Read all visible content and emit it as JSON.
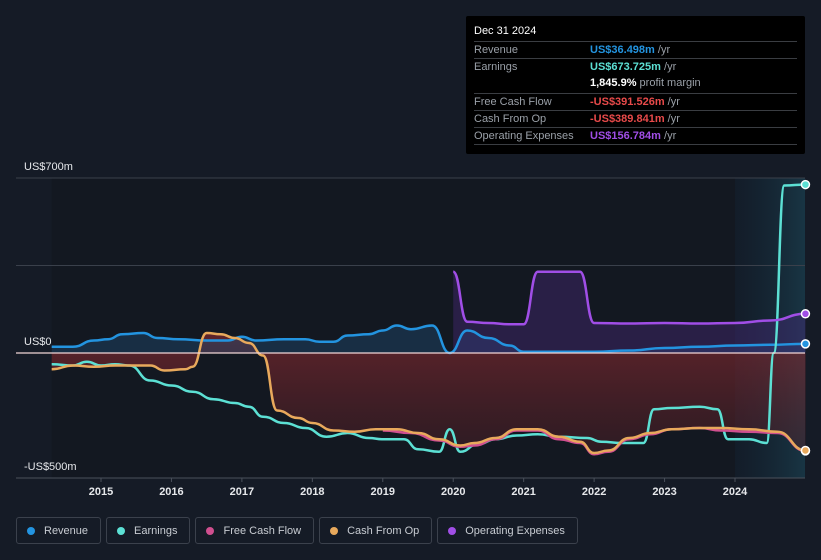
{
  "chart_data": {
    "type": "line",
    "title": "",
    "xlabel": "",
    "ylabel": "",
    "y_axis": {
      "top_label": "US$700m",
      "zero_label": "US$0",
      "bottom_label": "-US$500m",
      "ylim": [
        -500,
        700
      ],
      "unit": "US$m"
    },
    "x_ticks": [
      "2015",
      "2016",
      "2017",
      "2018",
      "2019",
      "2020",
      "2021",
      "2022",
      "2023",
      "2024"
    ],
    "x_range": [
      2014.3,
      2025.0
    ],
    "grid": true,
    "forecast_shade_start": 2024.0,
    "series": [
      {
        "name": "Revenue",
        "color": "#2394e0",
        "points": [
          [
            2014.3,
            25
          ],
          [
            2014.6,
            25
          ],
          [
            2014.9,
            50
          ],
          [
            2015.1,
            55
          ],
          [
            2015.3,
            75
          ],
          [
            2015.6,
            80
          ],
          [
            2015.8,
            60
          ],
          [
            2016.1,
            55
          ],
          [
            2016.5,
            50
          ],
          [
            2016.8,
            50
          ],
          [
            2017.0,
            65
          ],
          [
            2017.2,
            50
          ],
          [
            2017.6,
            55
          ],
          [
            2017.9,
            55
          ],
          [
            2018.1,
            45
          ],
          [
            2018.3,
            45
          ],
          [
            2018.5,
            70
          ],
          [
            2018.8,
            75
          ],
          [
            2019.0,
            90
          ],
          [
            2019.2,
            110
          ],
          [
            2019.4,
            95
          ],
          [
            2019.7,
            110
          ],
          [
            2019.95,
            0
          ],
          [
            2020.2,
            90
          ],
          [
            2020.5,
            60
          ],
          [
            2020.8,
            30
          ],
          [
            2021.0,
            5
          ],
          [
            2021.5,
            5
          ],
          [
            2022.0,
            5
          ],
          [
            2022.5,
            10
          ],
          [
            2023.0,
            20
          ],
          [
            2023.5,
            25
          ],
          [
            2024.0,
            30
          ],
          [
            2024.5,
            33
          ],
          [
            2025.0,
            36.5
          ]
        ]
      },
      {
        "name": "Earnings",
        "color": "#5ce0d4",
        "points": [
          [
            2014.3,
            -45
          ],
          [
            2014.6,
            -50
          ],
          [
            2014.8,
            -35
          ],
          [
            2015.0,
            -50
          ],
          [
            2015.2,
            -45
          ],
          [
            2015.4,
            -50
          ],
          [
            2015.7,
            -110
          ],
          [
            2016.0,
            -130
          ],
          [
            2016.3,
            -155
          ],
          [
            2016.6,
            -185
          ],
          [
            2016.9,
            -200
          ],
          [
            2017.1,
            -215
          ],
          [
            2017.3,
            -255
          ],
          [
            2017.6,
            -280
          ],
          [
            2017.9,
            -300
          ],
          [
            2018.2,
            -335
          ],
          [
            2018.5,
            -320
          ],
          [
            2018.8,
            -340
          ],
          [
            2019.0,
            -345
          ],
          [
            2019.3,
            -345
          ],
          [
            2019.5,
            -385
          ],
          [
            2019.8,
            -395
          ],
          [
            2019.95,
            -305
          ],
          [
            2020.1,
            -395
          ],
          [
            2020.35,
            -365
          ],
          [
            2020.6,
            -345
          ],
          [
            2020.9,
            -330
          ],
          [
            2021.2,
            -325
          ],
          [
            2021.5,
            -335
          ],
          [
            2021.9,
            -340
          ],
          [
            2022.1,
            -355
          ],
          [
            2022.4,
            -360
          ],
          [
            2022.7,
            -360
          ],
          [
            2022.85,
            -225
          ],
          [
            2023.1,
            -220
          ],
          [
            2023.5,
            -215
          ],
          [
            2023.75,
            -225
          ],
          [
            2023.9,
            -345
          ],
          [
            2024.2,
            -345
          ],
          [
            2024.45,
            -360
          ],
          [
            2024.55,
            0
          ],
          [
            2024.7,
            670
          ],
          [
            2025.0,
            673.7
          ]
        ]
      },
      {
        "name": "Free Cash Flow",
        "color": "#d04f8f",
        "points": [
          [
            2019.0,
            -310
          ],
          [
            2019.4,
            -320
          ],
          [
            2019.8,
            -350
          ],
          [
            2020.1,
            -375
          ],
          [
            2020.3,
            -370
          ],
          [
            2020.6,
            -345
          ],
          [
            2020.9,
            -310
          ],
          [
            2021.2,
            -310
          ],
          [
            2021.5,
            -345
          ],
          [
            2021.8,
            -360
          ],
          [
            2022.0,
            -405
          ],
          [
            2022.2,
            -395
          ],
          [
            2022.5,
            -345
          ],
          [
            2022.8,
            -325
          ],
          [
            2023.1,
            -305
          ],
          [
            2023.5,
            -300
          ],
          [
            2023.8,
            -310
          ],
          [
            2024.2,
            -315
          ],
          [
            2024.6,
            -320
          ],
          [
            2025.0,
            -391.5
          ]
        ]
      },
      {
        "name": "Cash From Op",
        "color": "#e8a95c",
        "points": [
          [
            2014.3,
            -65
          ],
          [
            2014.6,
            -50
          ],
          [
            2014.9,
            -55
          ],
          [
            2015.2,
            -50
          ],
          [
            2015.5,
            -50
          ],
          [
            2015.7,
            -50
          ],
          [
            2015.9,
            -70
          ],
          [
            2016.2,
            -65
          ],
          [
            2016.3,
            -55
          ],
          [
            2016.5,
            80
          ],
          [
            2016.7,
            75
          ],
          [
            2016.9,
            60
          ],
          [
            2017.1,
            40
          ],
          [
            2017.3,
            -10
          ],
          [
            2017.5,
            -230
          ],
          [
            2017.8,
            -260
          ],
          [
            2018.0,
            -280
          ],
          [
            2018.3,
            -310
          ],
          [
            2018.6,
            -315
          ],
          [
            2018.9,
            -305
          ],
          [
            2019.2,
            -305
          ],
          [
            2019.5,
            -320
          ],
          [
            2019.8,
            -345
          ],
          [
            2020.1,
            -370
          ],
          [
            2020.3,
            -360
          ],
          [
            2020.6,
            -340
          ],
          [
            2020.9,
            -305
          ],
          [
            2021.2,
            -305
          ],
          [
            2021.5,
            -335
          ],
          [
            2021.8,
            -355
          ],
          [
            2022.0,
            -400
          ],
          [
            2022.2,
            -390
          ],
          [
            2022.5,
            -340
          ],
          [
            2022.8,
            -320
          ],
          [
            2023.1,
            -305
          ],
          [
            2023.5,
            -300
          ],
          [
            2023.8,
            -300
          ],
          [
            2024.2,
            -305
          ],
          [
            2024.6,
            -315
          ],
          [
            2025.0,
            -389.8
          ]
        ]
      },
      {
        "name": "Operating Expenses",
        "color": "#a04ee6",
        "points": [
          [
            2020.0,
            325
          ],
          [
            2020.2,
            125
          ],
          [
            2020.5,
            120
          ],
          [
            2020.8,
            115
          ],
          [
            2021.0,
            115
          ],
          [
            2021.2,
            325
          ],
          [
            2021.5,
            325
          ],
          [
            2021.8,
            325
          ],
          [
            2022.0,
            120
          ],
          [
            2022.5,
            118
          ],
          [
            2023.0,
            120
          ],
          [
            2023.5,
            118
          ],
          [
            2024.0,
            120
          ],
          [
            2024.5,
            130
          ],
          [
            2025.0,
            156.8
          ]
        ]
      }
    ]
  },
  "tooltip": {
    "date": "Dec 31 2024",
    "rows": [
      {
        "label": "Revenue",
        "value": "US$36.498m",
        "unit": " /yr",
        "color": "#2394e0"
      },
      {
        "label": "Earnings",
        "value": "US$673.725m",
        "unit": " /yr",
        "color": "#5ce0d4"
      },
      {
        "label": "",
        "value": "1,845.9%",
        "unit": " profit margin",
        "color": "#ffffff"
      },
      {
        "label": "Free Cash Flow",
        "value": "-US$391.526m",
        "unit": " /yr",
        "color": "#e84a4a"
      },
      {
        "label": "Cash From Op",
        "value": "-US$389.841m",
        "unit": " /yr",
        "color": "#e84a4a"
      },
      {
        "label": "Operating Expenses",
        "value": "US$156.784m",
        "unit": " /yr",
        "color": "#a04ee6"
      }
    ]
  },
  "legend": [
    {
      "label": "Revenue",
      "color": "#2394e0"
    },
    {
      "label": "Earnings",
      "color": "#5ce0d4"
    },
    {
      "label": "Free Cash Flow",
      "color": "#d04f8f"
    },
    {
      "label": "Cash From Op",
      "color": "#e8a95c"
    },
    {
      "label": "Operating Expenses",
      "color": "#a04ee6"
    }
  ]
}
